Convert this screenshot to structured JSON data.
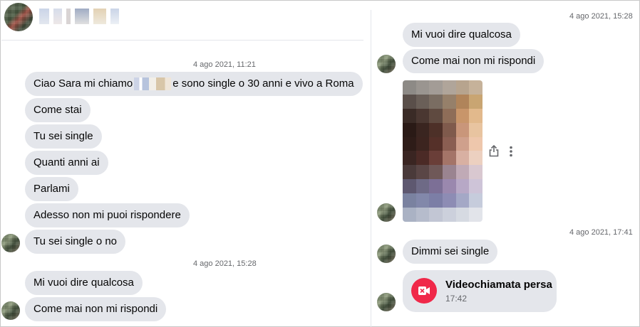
{
  "colors": {
    "bubble": "#e4e6eb",
    "missed_call": "#f02849",
    "meta_text": "#65676b"
  },
  "left_pane": {
    "header": {
      "contact_name_redacted": true,
      "avatar_icon": "profile-avatar"
    },
    "groups": [
      {
        "timestamp": "4 ago 2021, 11:21",
        "messages": [
          {
            "text_before": "Ciao Sara mi chiamo",
            "text_after": "e sono single o 30 anni e vivo a Roma"
          },
          {
            "text": "Come stai"
          },
          {
            "text": "Tu sei single"
          },
          {
            "text": "Quanti anni ai"
          },
          {
            "text": "Parlami"
          },
          {
            "text": "Adesso non mi puoi rispondere"
          },
          {
            "text": "Tu sei single o no"
          }
        ]
      },
      {
        "timestamp": "4 ago 2021, 15:28",
        "messages": [
          {
            "text": "Mi vuoi dire qualcosa"
          },
          {
            "text": "Come mai non mi rispondi"
          }
        ]
      }
    ]
  },
  "right_pane": {
    "groups": [
      {
        "timestamp": "4 ago 2021, 15:28",
        "messages": [
          {
            "text": "Mi vuoi dire qualcosa"
          },
          {
            "text": "Come mai non mi rispondi"
          }
        ],
        "photo": {
          "pixelated": true,
          "actions": [
            "share-icon",
            "more-options-icon"
          ]
        }
      },
      {
        "timestamp": "4 ago 2021, 17:41",
        "messages": [
          {
            "text": "Dimmi sei single"
          }
        ],
        "call": {
          "title": "Videochiamata persa",
          "time": "17:42",
          "icon": "missed-video-call-icon"
        }
      }
    ]
  }
}
